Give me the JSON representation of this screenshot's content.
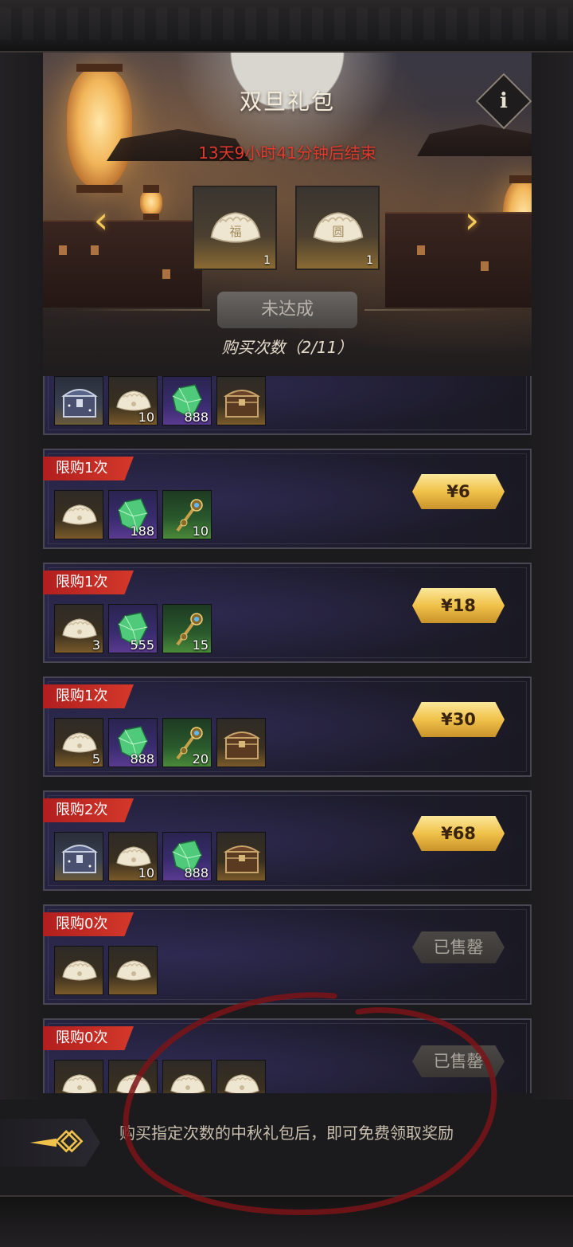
{
  "banner": {
    "title": "双旦礼包",
    "timer": "13天9小时41分钟后结束",
    "info_icon": "i",
    "prev_arrow": "‹",
    "next_arrow": "›",
    "rewards": [
      {
        "icon": "dumpling-icon",
        "count": "1"
      },
      {
        "icon": "dumpling-icon",
        "count": "1"
      }
    ],
    "status": "未达成",
    "purchase_count": "购买次数（2/11）"
  },
  "packs": [
    {
      "limit": "",
      "items": [
        {
          "icon": "silver-chest-icon",
          "qty": ""
        },
        {
          "icon": "dumpling-icon",
          "qty": "10"
        },
        {
          "icon": "green-crystal-icon",
          "qty": "888"
        },
        {
          "icon": "wooden-chest-icon",
          "qty": ""
        }
      ],
      "price": "",
      "sold": false
    },
    {
      "limit": "限购1次",
      "items": [
        {
          "icon": "dumpling-icon",
          "qty": ""
        },
        {
          "icon": "green-crystal-icon",
          "qty": "188"
        },
        {
          "icon": "scepter-icon",
          "qty": "10"
        }
      ],
      "price": "¥6",
      "sold": false
    },
    {
      "limit": "限购1次",
      "items": [
        {
          "icon": "dumpling-icon",
          "qty": "3"
        },
        {
          "icon": "green-crystal-icon",
          "qty": "555"
        },
        {
          "icon": "scepter-icon",
          "qty": "15"
        }
      ],
      "price": "¥18",
      "sold": false
    },
    {
      "limit": "限购1次",
      "items": [
        {
          "icon": "dumpling-icon",
          "qty": "5"
        },
        {
          "icon": "green-crystal-icon",
          "qty": "888"
        },
        {
          "icon": "scepter-icon",
          "qty": "20"
        },
        {
          "icon": "wooden-chest-icon",
          "qty": ""
        }
      ],
      "price": "¥30",
      "sold": false
    },
    {
      "limit": "限购2次",
      "items": [
        {
          "icon": "silver-chest-icon",
          "qty": ""
        },
        {
          "icon": "dumpling-icon",
          "qty": "10"
        },
        {
          "icon": "green-crystal-icon",
          "qty": "888"
        },
        {
          "icon": "wooden-chest-icon",
          "qty": ""
        }
      ],
      "price": "¥68",
      "sold": false
    },
    {
      "limit": "限购0次",
      "items": [
        {
          "icon": "dumpling-icon",
          "qty": ""
        },
        {
          "icon": "dumpling-icon",
          "qty": ""
        }
      ],
      "price": "已售罄",
      "sold": true
    },
    {
      "limit": "限购0次",
      "items": [
        {
          "icon": "dumpling-icon",
          "qty": ""
        },
        {
          "icon": "dumpling-icon",
          "qty": ""
        },
        {
          "icon": "dumpling-icon",
          "qty": ""
        },
        {
          "icon": "dumpling-icon",
          "qty": ""
        }
      ],
      "price": "已售罄",
      "sold": true
    }
  ],
  "footer": {
    "hint": "购买指定次数的中秋礼包后，即可免费领取奖励"
  },
  "colors": {
    "timer_red": "#e23a2e",
    "gold_button": "#f0c24a",
    "limit_tag_red": "#c42a24",
    "panel_purple": "#24223e"
  }
}
